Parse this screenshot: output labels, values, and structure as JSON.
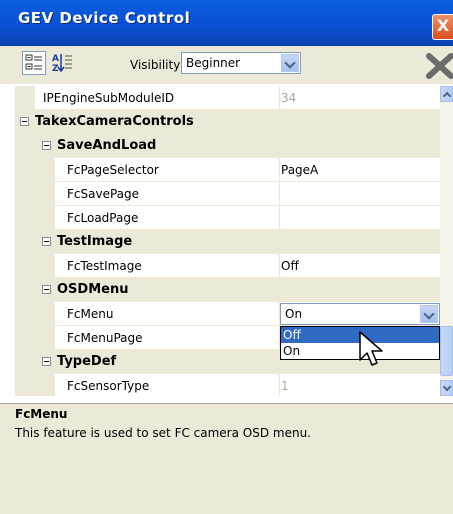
{
  "window": {
    "title": "GEV Device Control",
    "close_glyph": "X"
  },
  "toolbar": {
    "visibility_label": "Visibility",
    "visibility_value": "Beginner",
    "categorized_icon": "categorized-view-icon",
    "alphabetical_icon": "alphabetical-sort-icon",
    "clear_icon": "clear-x-icon"
  },
  "grid": {
    "rows": [
      {
        "name": "IPEngineSubModuleID",
        "value": "34",
        "type": "property",
        "readonly": true
      },
      {
        "name": "TakexCameraControls",
        "type": "category"
      },
      {
        "name": "SaveAndLoad",
        "type": "subcategory"
      },
      {
        "name": "FcPageSelector",
        "value": "PageA",
        "type": "property"
      },
      {
        "name": "FcSavePage",
        "value": "",
        "type": "property"
      },
      {
        "name": "FcLoadPage",
        "value": "",
        "type": "property"
      },
      {
        "name": "TestImage",
        "type": "subcategory"
      },
      {
        "name": "FcTestImage",
        "value": "Off",
        "type": "property"
      },
      {
        "name": "OSDMenu",
        "type": "subcategory"
      },
      {
        "name": "FcMenu",
        "value": "On",
        "type": "property"
      },
      {
        "name": "FcMenuPage",
        "value": "",
        "type": "property"
      },
      {
        "name": "TypeDef",
        "type": "subcategory"
      },
      {
        "name": "FcSensorType",
        "value": "1",
        "type": "property",
        "readonly": true
      }
    ],
    "dropdown_options": [
      "Off",
      "On"
    ],
    "dropdown_highlighted": "Off"
  },
  "description": {
    "title": "FcMenu",
    "text": "This feature is used to set FC camera OSD menu."
  },
  "colors": {
    "titlebar": "#0a4fd6",
    "selection": "#316ac5",
    "panel": "#ece9d8"
  }
}
